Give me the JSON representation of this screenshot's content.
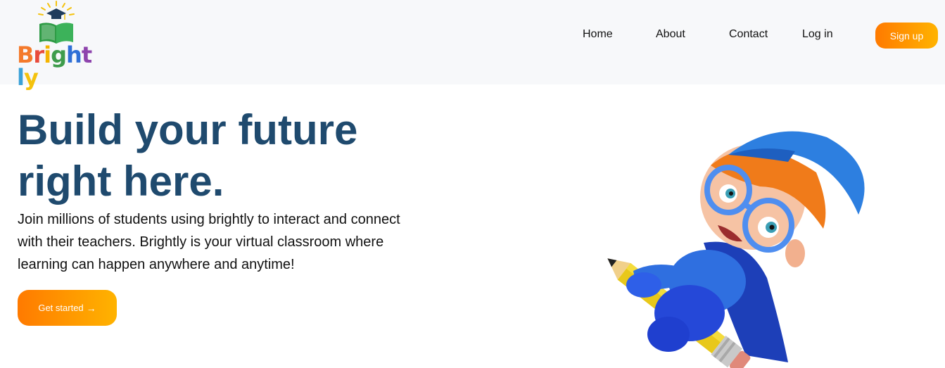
{
  "brand": {
    "name_letters": [
      "B",
      "r",
      "i",
      "g",
      "h",
      "t",
      "l",
      "y"
    ],
    "letter_colors": [
      "#f47a2b",
      "#e84b3c",
      "#f4b400",
      "#3e9c4b",
      "#2f6fd6",
      "#8e44ad",
      "#3aa1d8",
      "#f4c20d"
    ]
  },
  "nav": {
    "home": "Home",
    "about": "About",
    "contact": "Contact",
    "login": "Log in",
    "signup": "Sign up"
  },
  "hero": {
    "title_line1": "Build your future",
    "title_line2": "right here.",
    "description": "Join millions of students using brightly to interact and connect with their teachers. Brightly is your virtual classroom where learning can happen anywhere and anytime!",
    "cta_label": "Get started",
    "cta_icon": "arrow-right-icon"
  },
  "colors": {
    "title": "#1f4a6e",
    "accent_start": "#ff7a00",
    "accent_end": "#ffb300",
    "header_bg": "#f7f8fa"
  },
  "illustration": {
    "icon": "kid-riding-pencil-illustration"
  }
}
